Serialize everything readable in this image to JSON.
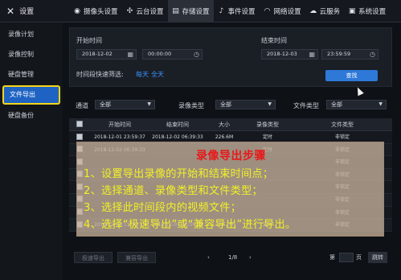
{
  "app": {
    "title": "设置"
  },
  "nav": {
    "items": [
      {
        "label": "摄像头设置",
        "icon": "camera-icon"
      },
      {
        "label": "云台设置",
        "icon": "ptz-icon"
      },
      {
        "label": "存储设置",
        "icon": "storage-icon",
        "active": true
      },
      {
        "label": "事件设置",
        "icon": "bell-icon"
      },
      {
        "label": "网络设置",
        "icon": "wifi-icon"
      },
      {
        "label": "云服务",
        "icon": "cloud-icon"
      },
      {
        "label": "系统设置",
        "icon": "system-icon"
      }
    ]
  },
  "sidebar": {
    "items": [
      {
        "label": "录像计划"
      },
      {
        "label": "录像控制"
      },
      {
        "label": "硬盘管理"
      },
      {
        "label": "文件导出",
        "active": true
      },
      {
        "label": "硬盘备份"
      }
    ]
  },
  "filter": {
    "start_label": "开始时间",
    "start_date": "2018-12-02",
    "start_time": "00:00:00",
    "end_label": "结束时间",
    "end_date": "2018-12-03",
    "end_time": "23:59:59",
    "quick_label": "时间段快速筛选:",
    "quick_day": "每天",
    "quick_all": "全天",
    "search_button": "查找"
  },
  "selectors": {
    "channel_label": "通道",
    "channel_value": "全部",
    "rec_type_label": "录像类型",
    "rec_type_value": "全部",
    "file_type_label": "文件类型",
    "file_type_value": "全部"
  },
  "table": {
    "headers": [
      "开始时间",
      "结束时间",
      "大小",
      "录像类型",
      "文件类型"
    ],
    "rows": [
      {
        "start": "2018-12-01 23:59:37",
        "end": "2018-12-02 06:39:33",
        "size": "226.6M",
        "rec_type": "定时",
        "file_type": "非锁定"
      },
      {
        "start": "2018-12-02 06:39:33",
        "end": "",
        "size": "",
        "rec_type": "定时",
        "file_type": "非锁定"
      },
      {
        "start": "",
        "end": "",
        "size": "",
        "rec_type": "",
        "file_type": "非锁定"
      },
      {
        "start": "",
        "end": "",
        "size": "",
        "rec_type": "",
        "file_type": "非锁定"
      },
      {
        "start": "",
        "end": "",
        "size": "",
        "rec_type": "",
        "file_type": "非锁定"
      },
      {
        "start": "",
        "end": "",
        "size": "",
        "rec_type": "",
        "file_type": "非锁定"
      },
      {
        "start": "",
        "end": "",
        "size": "",
        "rec_type": "",
        "file_type": "非锁定"
      },
      {
        "start": "2018-12-03 11:18:27",
        "end": "2018-12-03 23:59:59",
        "size": "215.2M",
        "rec_type": "定时",
        "file_type": "非锁定"
      }
    ]
  },
  "bottom": {
    "fast_export": "极速导出",
    "compat_export": "兼容导出",
    "page_info": "1/8",
    "page_prefix": "第",
    "page_suffix": "页",
    "go": "跳转"
  },
  "overlay": {
    "title": "录像导出步骤",
    "lines": [
      "1、设置导出录像的开始和结束时间点；",
      "2、选择通道、录像类型和文件类型；",
      "3、选择此时间段内的视频文件；",
      "4、选择“极速导出”或“兼容导出”进行导出。"
    ]
  },
  "colors": {
    "accent": "#2e78d8",
    "highlight_border": "#f5d51a",
    "overlay_title": "#e81818",
    "overlay_text": "#f2f025"
  }
}
